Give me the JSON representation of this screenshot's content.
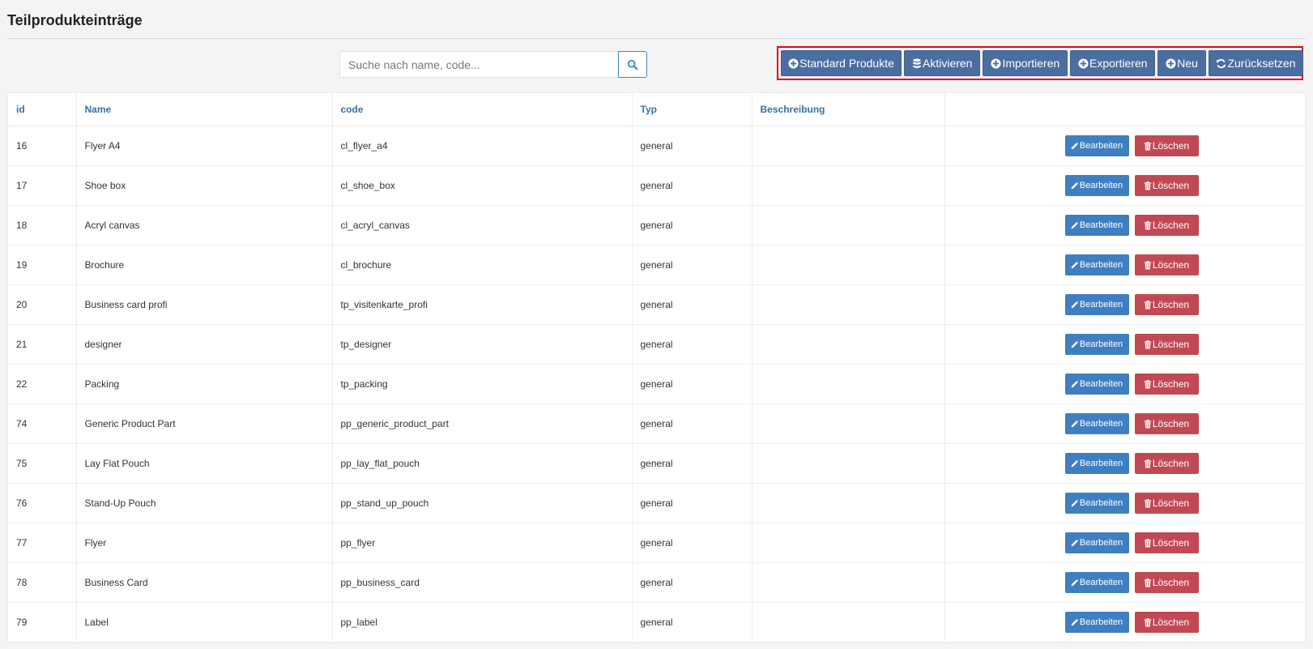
{
  "page": {
    "title": "Teilprodukteinträge"
  },
  "search": {
    "placeholder": "Suche nach name, code..."
  },
  "actions": {
    "standard_label": "Standard Produkte",
    "activate_label": "Aktivieren",
    "import_label": "Importieren",
    "export_label": "Exportieren",
    "new_label": "Neu",
    "reset_label": "Zurücksetzen"
  },
  "table": {
    "headers": {
      "id": "id",
      "name": "Name",
      "code": "code",
      "type": "Typ",
      "description": "Beschreibung"
    },
    "edit_label": "Bearbeiten",
    "delete_label": "Löschen",
    "rows": [
      {
        "id": "16",
        "name": "Flyer A4",
        "code": "cl_flyer_a4",
        "type": "general",
        "description": ""
      },
      {
        "id": "17",
        "name": "Shoe box",
        "code": "cl_shoe_box",
        "type": "general",
        "description": ""
      },
      {
        "id": "18",
        "name": "Acryl canvas",
        "code": "cl_acryl_canvas",
        "type": "general",
        "description": ""
      },
      {
        "id": "19",
        "name": "Brochure",
        "code": "cl_brochure",
        "type": "general",
        "description": ""
      },
      {
        "id": "20",
        "name": "Business card profi",
        "code": "tp_visitenkarte_profi",
        "type": "general",
        "description": ""
      },
      {
        "id": "21",
        "name": "designer",
        "code": "tp_designer",
        "type": "general",
        "description": ""
      },
      {
        "id": "22",
        "name": "Packing",
        "code": "tp_packing",
        "type": "general",
        "description": ""
      },
      {
        "id": "74",
        "name": "Generic Product Part",
        "code": "pp_generic_product_part",
        "type": "general",
        "description": ""
      },
      {
        "id": "75",
        "name": "Lay Flat Pouch",
        "code": "pp_lay_flat_pouch",
        "type": "general",
        "description": ""
      },
      {
        "id": "76",
        "name": "Stand-Up Pouch",
        "code": "pp_stand_up_pouch",
        "type": "general",
        "description": ""
      },
      {
        "id": "77",
        "name": "Flyer",
        "code": "pp_flyer",
        "type": "general",
        "description": ""
      },
      {
        "id": "78",
        "name": "Business Card",
        "code": "pp_business_card",
        "type": "general",
        "description": ""
      },
      {
        "id": "79",
        "name": "Label",
        "code": "pp_label",
        "type": "general",
        "description": ""
      }
    ]
  },
  "icons": {
    "search": "search-icon",
    "plus": "plus-circle-icon",
    "database": "database-icon",
    "refresh": "refresh-icon",
    "edit": "pencil-icon",
    "delete": "trash-icon"
  },
  "colors": {
    "primary_action": "#4a6ea0",
    "edit": "#3f7fc1",
    "delete": "#c14954",
    "highlight_border": "#e3001b",
    "header_text": "#3b6ea5"
  }
}
